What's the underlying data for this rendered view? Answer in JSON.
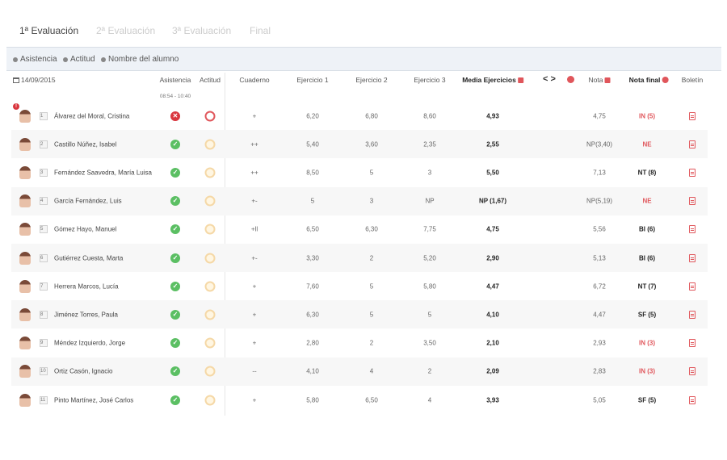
{
  "tabs": [
    {
      "label": "1ª Evaluación",
      "active": true
    },
    {
      "label": "2ª Evaluación",
      "active": false
    },
    {
      "label": "3ª Evaluación",
      "active": false
    },
    {
      "label": "Final",
      "active": false
    }
  ],
  "filters": [
    {
      "label": "Asistencia"
    },
    {
      "label": "Actitud"
    },
    {
      "label": "Nombre del alumno"
    }
  ],
  "header": {
    "date": "14/09/2015",
    "asistencia": "Asistencia",
    "asistencia_time": "08:54 - 10:40",
    "actitud": "Actitud",
    "cuaderno": "Cuaderno",
    "ejercicio1": "Ejercicio 1",
    "ejercicio2": "Ejercicio 2",
    "ejercicio3": "Ejercicio 3",
    "media": "Media Ejercicios",
    "nav": "< >",
    "nota": "Nota",
    "nota_final": "Nota final",
    "boletin": "Boletín"
  },
  "colors": {
    "accent_red": "#e0565b",
    "ok_green": "#5bbf63",
    "absent_red": "#d9363e"
  },
  "students": [
    {
      "num": "1",
      "name": "Álvarez del Moral, Cristina",
      "asistencia": "absent",
      "actitud": "bad",
      "cuaderno": "+",
      "ej1": "6,20",
      "ej2": "6,80",
      "ej3": "8,60",
      "media": "4,93",
      "nota": "4,75",
      "final": "IN (5)",
      "final_style": "red",
      "warning": true
    },
    {
      "num": "2",
      "name": "Castillo Núñez, Isabel",
      "asistencia": "present",
      "actitud": "neutral",
      "cuaderno": "++",
      "ej1": "5,40",
      "ej2": "3,60",
      "ej3": "2,35",
      "media": "2,55",
      "nota": "NP(3,40)",
      "final": "NE",
      "final_style": "red"
    },
    {
      "num": "3",
      "name": "Fernández Saavedra, María Luisa",
      "asistencia": "present",
      "actitud": "neutral",
      "cuaderno": "++",
      "ej1": "8,50",
      "ej2": "5",
      "ej3": "3",
      "media": "5,50",
      "nota": "7,13",
      "final": "NT (8)",
      "final_style": "dark"
    },
    {
      "num": "4",
      "name": "García Fernández, Luis",
      "asistencia": "present",
      "actitud": "neutral",
      "cuaderno": "+-",
      "ej1": "5",
      "ej2": "3",
      "ej3": "NP",
      "media": "NP (1,67)",
      "nota": "NP(5,19)",
      "final": "NE",
      "final_style": "red"
    },
    {
      "num": "5",
      "name": "Gómez Hayo, Manuel",
      "asistencia": "present",
      "actitud": "neutral",
      "cuaderno": "+ll",
      "ej1": "6,50",
      "ej2": "6,30",
      "ej3": "7,75",
      "media": "4,75",
      "nota": "5,56",
      "final": "BI (6)",
      "final_style": "dark"
    },
    {
      "num": "6",
      "name": "Gutiérrez Cuesta, Marta",
      "asistencia": "present",
      "actitud": "neutral",
      "cuaderno": "+-",
      "ej1": "3,30",
      "ej2": "2",
      "ej3": "5,20",
      "media": "2,90",
      "nota": "5,13",
      "final": "BI (6)",
      "final_style": "dark"
    },
    {
      "num": "7",
      "name": "Herrera Marcos, Lucía",
      "asistencia": "present",
      "actitud": "neutral",
      "cuaderno": "+",
      "ej1": "7,60",
      "ej2": "5",
      "ej3": "5,80",
      "media": "4,47",
      "nota": "6,72",
      "final": "NT (7)",
      "final_style": "dark"
    },
    {
      "num": "8",
      "name": "Jiménez Torres, Paula",
      "asistencia": "present",
      "actitud": "neutral",
      "cuaderno": "+",
      "ej1": "6,30",
      "ej2": "5",
      "ej3": "5",
      "media": "4,10",
      "nota": "4,47",
      "final": "SF (5)",
      "final_style": "dark"
    },
    {
      "num": "9",
      "name": "Méndez Izquierdo, Jorge",
      "asistencia": "present",
      "actitud": "neutral",
      "cuaderno": "+",
      "ej1": "2,80",
      "ej2": "2",
      "ej3": "3,50",
      "media": "2,10",
      "nota": "2,93",
      "final": "IN (3)",
      "final_style": "red"
    },
    {
      "num": "10",
      "name": "Ortiz Casón, Ignacio",
      "asistencia": "present",
      "actitud": "neutral",
      "cuaderno": "--",
      "ej1": "4,10",
      "ej2": "4",
      "ej3": "2",
      "media": "2,09",
      "nota": "2,83",
      "final": "IN (3)",
      "final_style": "red"
    },
    {
      "num": "11",
      "name": "Pinto Martínez, José Carlos",
      "asistencia": "present",
      "actitud": "neutral",
      "cuaderno": "+",
      "ej1": "5,80",
      "ej2": "6,50",
      "ej3": "4",
      "media": "3,93",
      "nota": "5,05",
      "final": "SF (5)",
      "final_style": "dark"
    }
  ]
}
